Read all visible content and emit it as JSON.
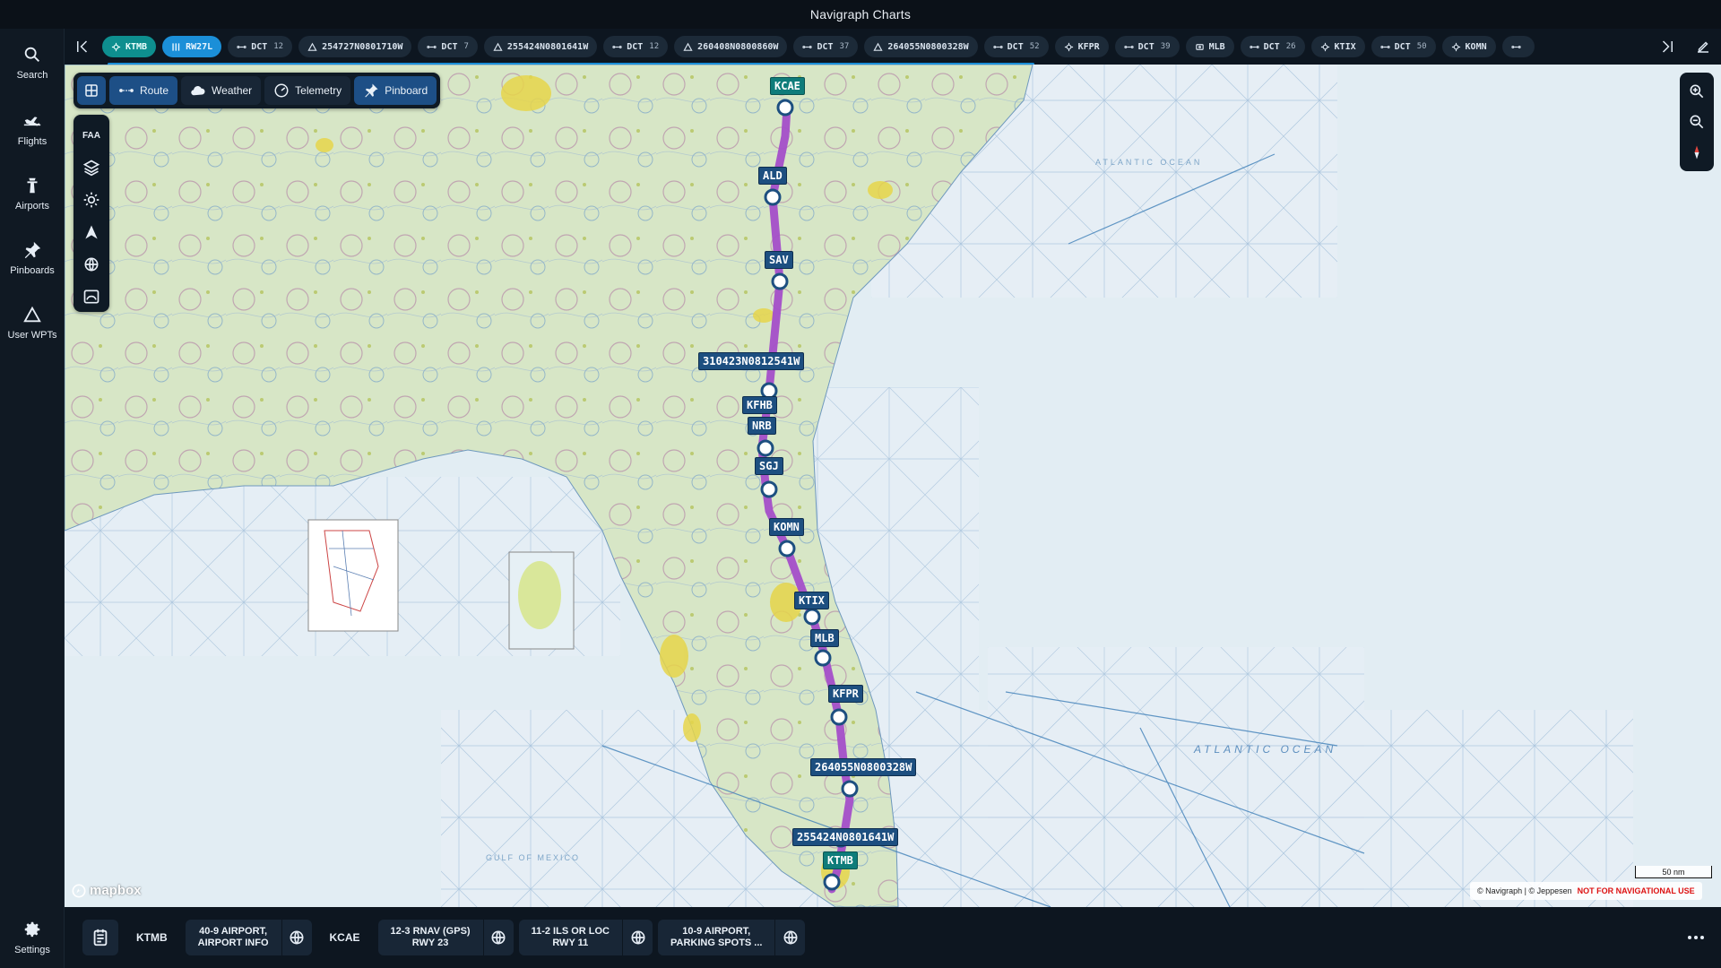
{
  "app": {
    "title": "Navigraph Charts"
  },
  "rail": {
    "items": [
      {
        "label": "Search",
        "icon": "search-icon"
      },
      {
        "label": "Flights",
        "icon": "airplane-icon"
      },
      {
        "label": "Airports",
        "icon": "tower-icon"
      },
      {
        "label": "Pinboards",
        "icon": "pin-icon"
      },
      {
        "label": "User WPTs",
        "icon": "triangle-icon"
      }
    ],
    "settings": {
      "label": "Settings",
      "icon": "gear-icon"
    }
  },
  "route": {
    "chips": [
      {
        "label": "KTMB",
        "kind": "airport",
        "style": "teal"
      },
      {
        "label": "RW27L",
        "kind": "runway",
        "style": "blue"
      },
      {
        "label": "DCT",
        "kind": "dct",
        "num": "12"
      },
      {
        "label": "254727N0801710W",
        "kind": "userwpt"
      },
      {
        "label": "DCT",
        "kind": "dct",
        "num": "7"
      },
      {
        "label": "255424N0801641W",
        "kind": "userwpt"
      },
      {
        "label": "DCT",
        "kind": "dct",
        "num": "12"
      },
      {
        "label": "260408N0800860W",
        "kind": "userwpt"
      },
      {
        "label": "DCT",
        "kind": "dct",
        "num": "37"
      },
      {
        "label": "264055N0800328W",
        "kind": "userwpt"
      },
      {
        "label": "DCT",
        "kind": "dct",
        "num": "52"
      },
      {
        "label": "KFPR",
        "kind": "airport"
      },
      {
        "label": "DCT",
        "kind": "dct",
        "num": "39"
      },
      {
        "label": "MLB",
        "kind": "vor"
      },
      {
        "label": "DCT",
        "kind": "dct",
        "num": "26"
      },
      {
        "label": "KTIX",
        "kind": "airport"
      },
      {
        "label": "DCT",
        "kind": "dct",
        "num": "50"
      },
      {
        "label": "KOMN",
        "kind": "airport"
      },
      {
        "label": "",
        "kind": "dct",
        "num": ""
      }
    ]
  },
  "map_toolbar": {
    "route": "Route",
    "weather": "Weather",
    "telemetry": "Telemetry",
    "pinboard": "Pinboard",
    "faa": "FAA"
  },
  "waypoints": [
    {
      "label": "KCAE",
      "style": "teal"
    },
    {
      "label": "ALD"
    },
    {
      "label": "SAV"
    },
    {
      "label": "310423N0812541W"
    },
    {
      "label": "KFHB"
    },
    {
      "label": "NRB"
    },
    {
      "label": "SGJ"
    },
    {
      "label": "KOMN"
    },
    {
      "label": "KTIX"
    },
    {
      "label": "MLB"
    },
    {
      "label": "KFPR"
    },
    {
      "label": "264055N0800328W"
    },
    {
      "label": "255424N0801641W"
    },
    {
      "label": "KTMB",
      "style": "teal"
    }
  ],
  "map_text": {
    "ocean_top": "ATLANTIC OCEAN",
    "ocean_bottom": "ATLANTIC OCEAN",
    "gulf": "GULF OF MEXICO",
    "scale": "50 nm",
    "mapbox": "mapbox",
    "copyright": "© Navigraph | © Jeppesen",
    "warning": "NOT FOR NAVIGATIONAL USE"
  },
  "bottom": {
    "origin": "KTMB",
    "dest": "KCAE",
    "tabs": [
      {
        "label": "40-9 AIRPORT,\nAIRPORT INFO"
      },
      {
        "label": "12-3 RNAV (GPS)\nRWY 23"
      },
      {
        "label": "11-2 ILS OR LOC\nRWY 11"
      },
      {
        "label": "10-9 AIRPORT,\nPARKING SPOTS ..."
      }
    ]
  },
  "colors": {
    "route_line": "#a44ec9",
    "land": "#d9e7c9",
    "water": "#e2edf3",
    "accent_blue": "#1b8fd8",
    "accent_teal": "#0e8f8f"
  }
}
